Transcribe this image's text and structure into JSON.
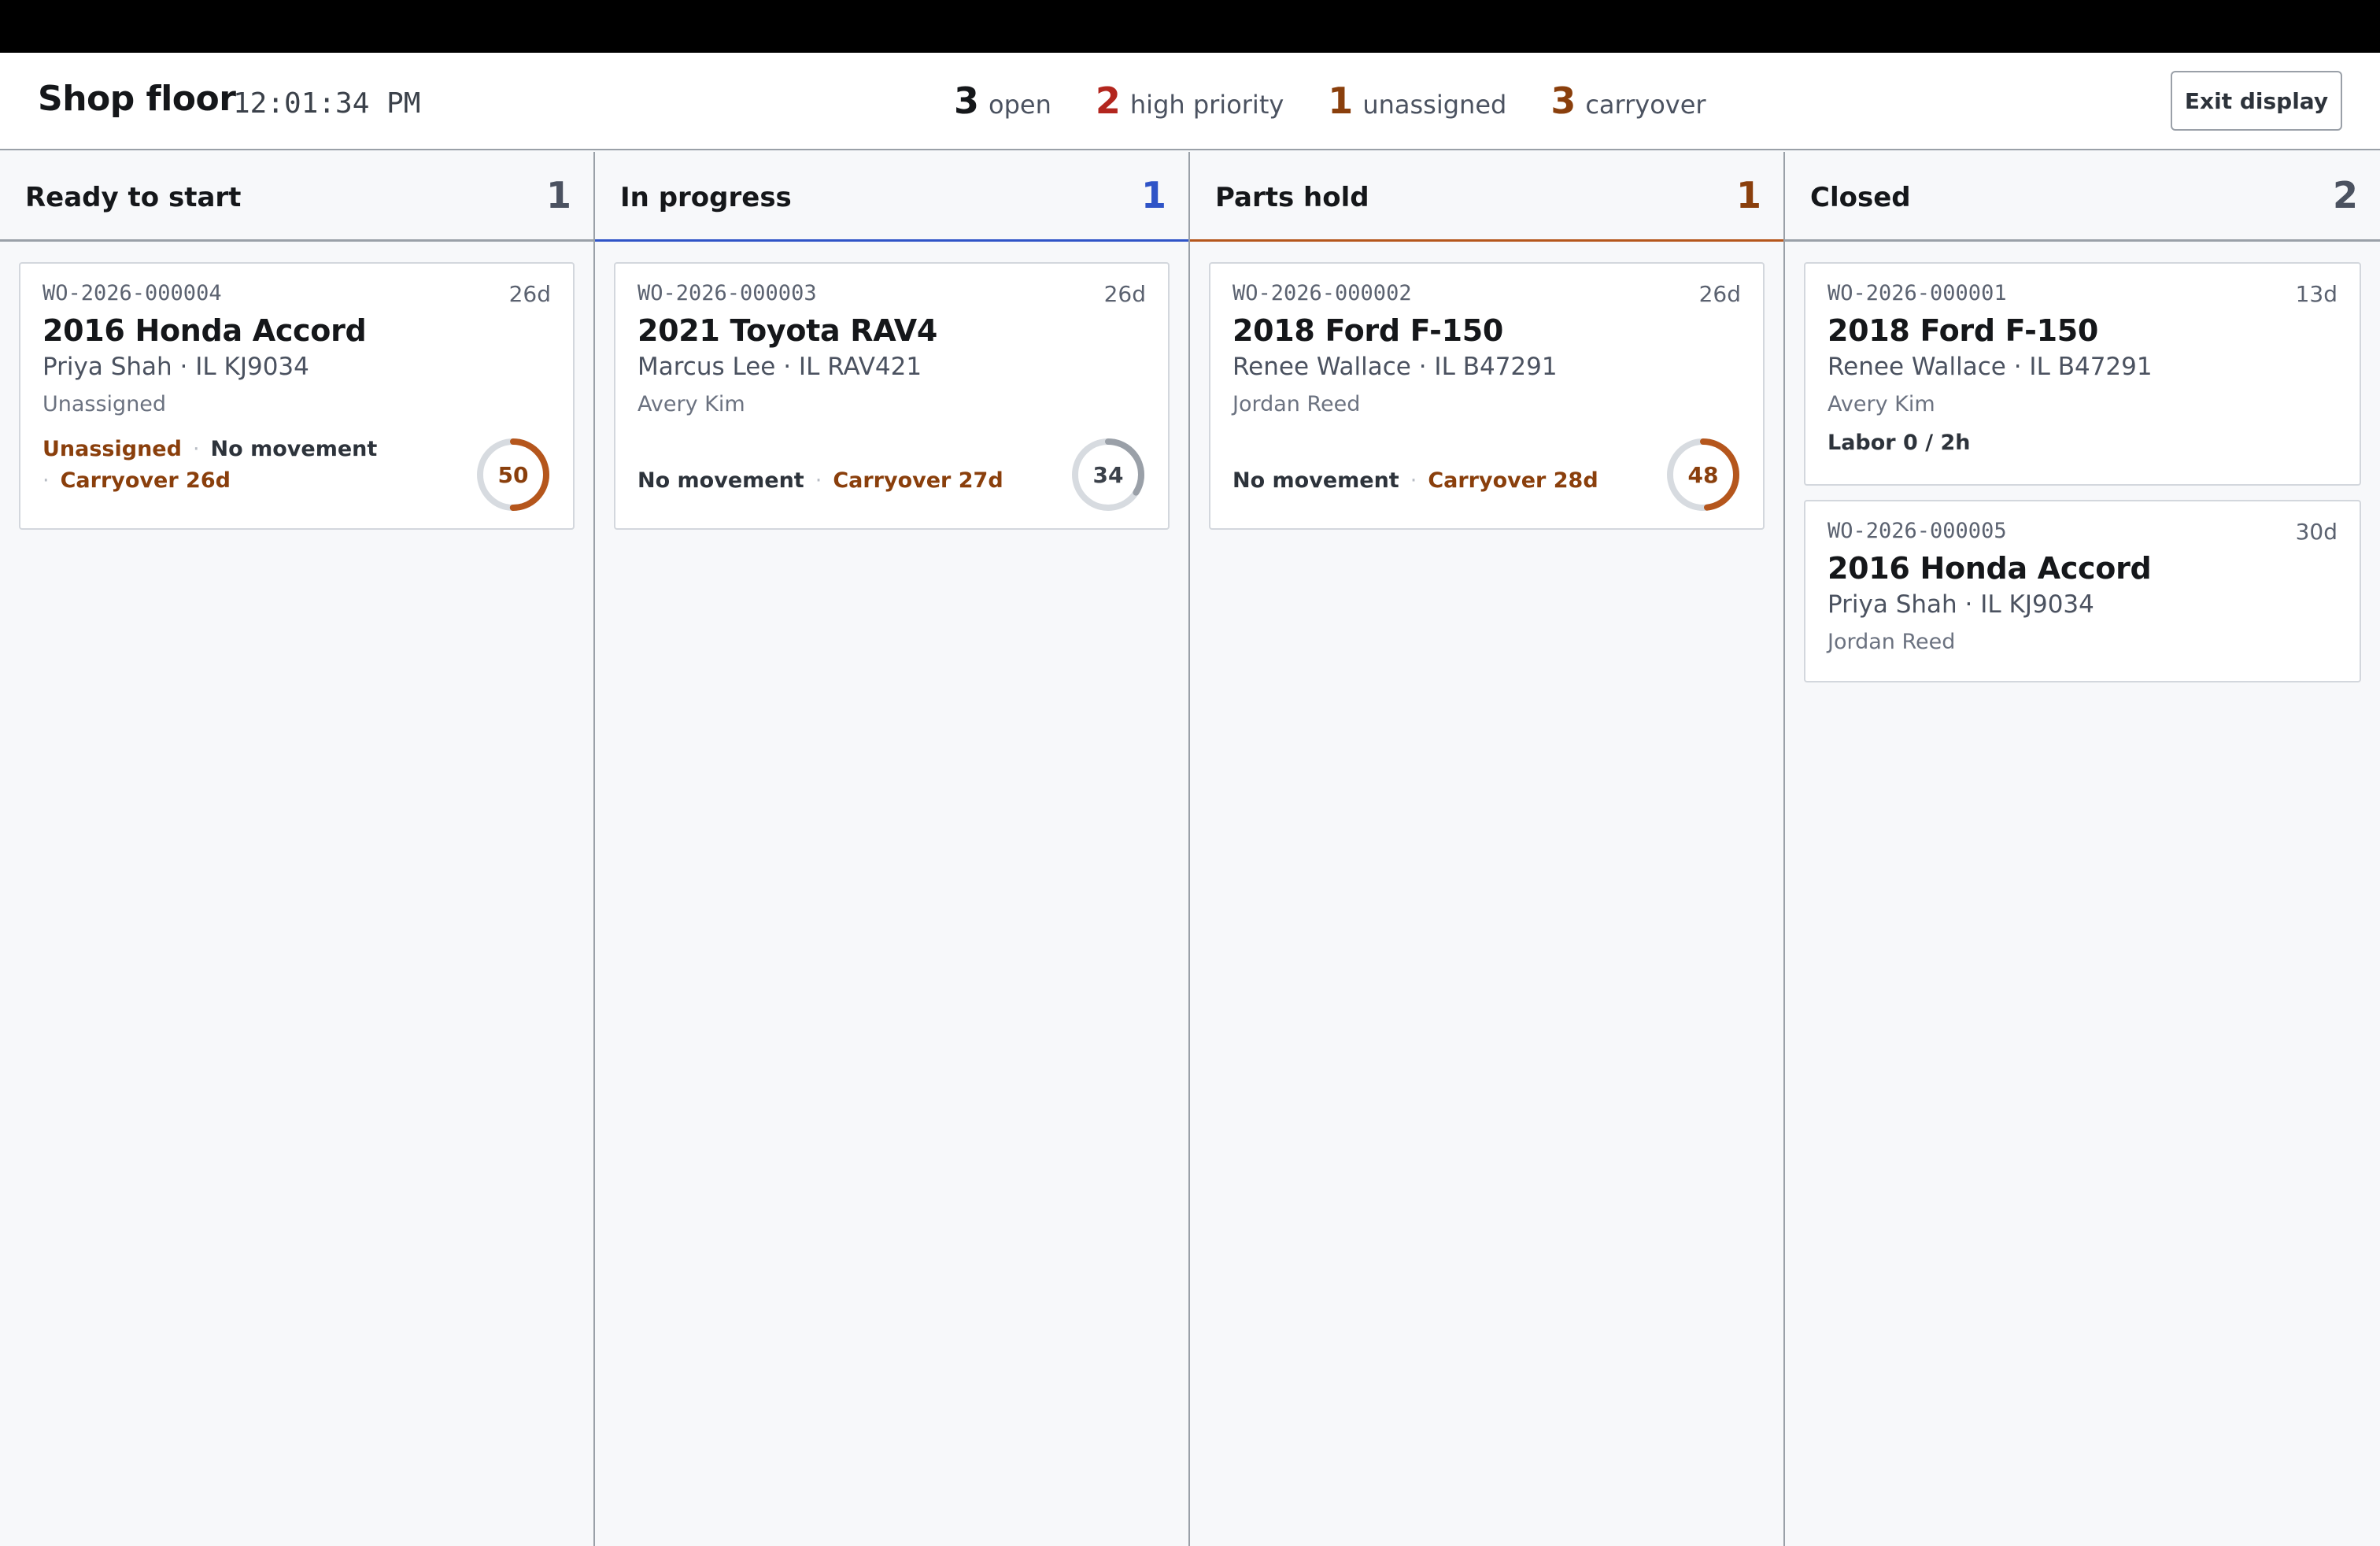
{
  "header": {
    "title": "Shop floor",
    "clock": "12:01:34 PM",
    "stats": [
      {
        "value": "3",
        "label": "open",
        "color": "#15171a"
      },
      {
        "value": "2",
        "label": "high priority",
        "color": "#b3261e"
      },
      {
        "value": "1",
        "label": "unassigned",
        "color": "#8a3f0c"
      },
      {
        "value": "3",
        "label": "carryover",
        "color": "#8a3f0c"
      }
    ],
    "exit_label": "Exit display"
  },
  "colors": {
    "accent_blue": "#2f54c7",
    "accent_orange": "#b5561c",
    "neutral": "#9aa0a8",
    "warn_text": "#8a3f0c"
  },
  "columns": [
    {
      "name": "Ready to start",
      "count": "1",
      "cards": [
        {
          "wo": "WO-2026-000004",
          "age": "26d",
          "vehicle": "2016 Honda Accord",
          "customer": "Priya Shah · IL KJ9034",
          "tech": "Unassigned",
          "flags": [
            "Unassigned",
            "No movement",
            "Carryover 26d"
          ],
          "score": "50",
          "score_pct": 50
        }
      ]
    },
    {
      "name": "In progress",
      "count": "1",
      "cards": [
        {
          "wo": "WO-2026-000003",
          "age": "26d",
          "vehicle": "2021 Toyota RAV4",
          "customer": "Marcus Lee · IL RAV421",
          "tech": "Avery Kim",
          "flags": [
            "No movement",
            "Carryover 27d"
          ],
          "score": "34",
          "score_pct": 34
        }
      ]
    },
    {
      "name": "Parts hold",
      "count": "1",
      "cards": [
        {
          "wo": "WO-2026-000002",
          "age": "26d",
          "vehicle": "2018 Ford F-150",
          "customer": "Renee Wallace · IL B47291",
          "tech": "Jordan Reed",
          "flags": [
            "No movement",
            "Carryover 28d"
          ],
          "score": "48",
          "score_pct": 48
        }
      ]
    },
    {
      "name": "Closed",
      "count": "2",
      "cards": [
        {
          "wo": "WO-2026-000001",
          "age": "13d",
          "vehicle": "2018 Ford F-150",
          "customer": "Renee Wallace · IL B47291",
          "tech": "Avery Kim",
          "labor": "Labor 0 / 2h"
        },
        {
          "wo": "WO-2026-000005",
          "age": "30d",
          "vehicle": "2016 Honda Accord",
          "customer": "Priya Shah · IL KJ9034",
          "tech": "Jordan Reed"
        }
      ]
    }
  ]
}
